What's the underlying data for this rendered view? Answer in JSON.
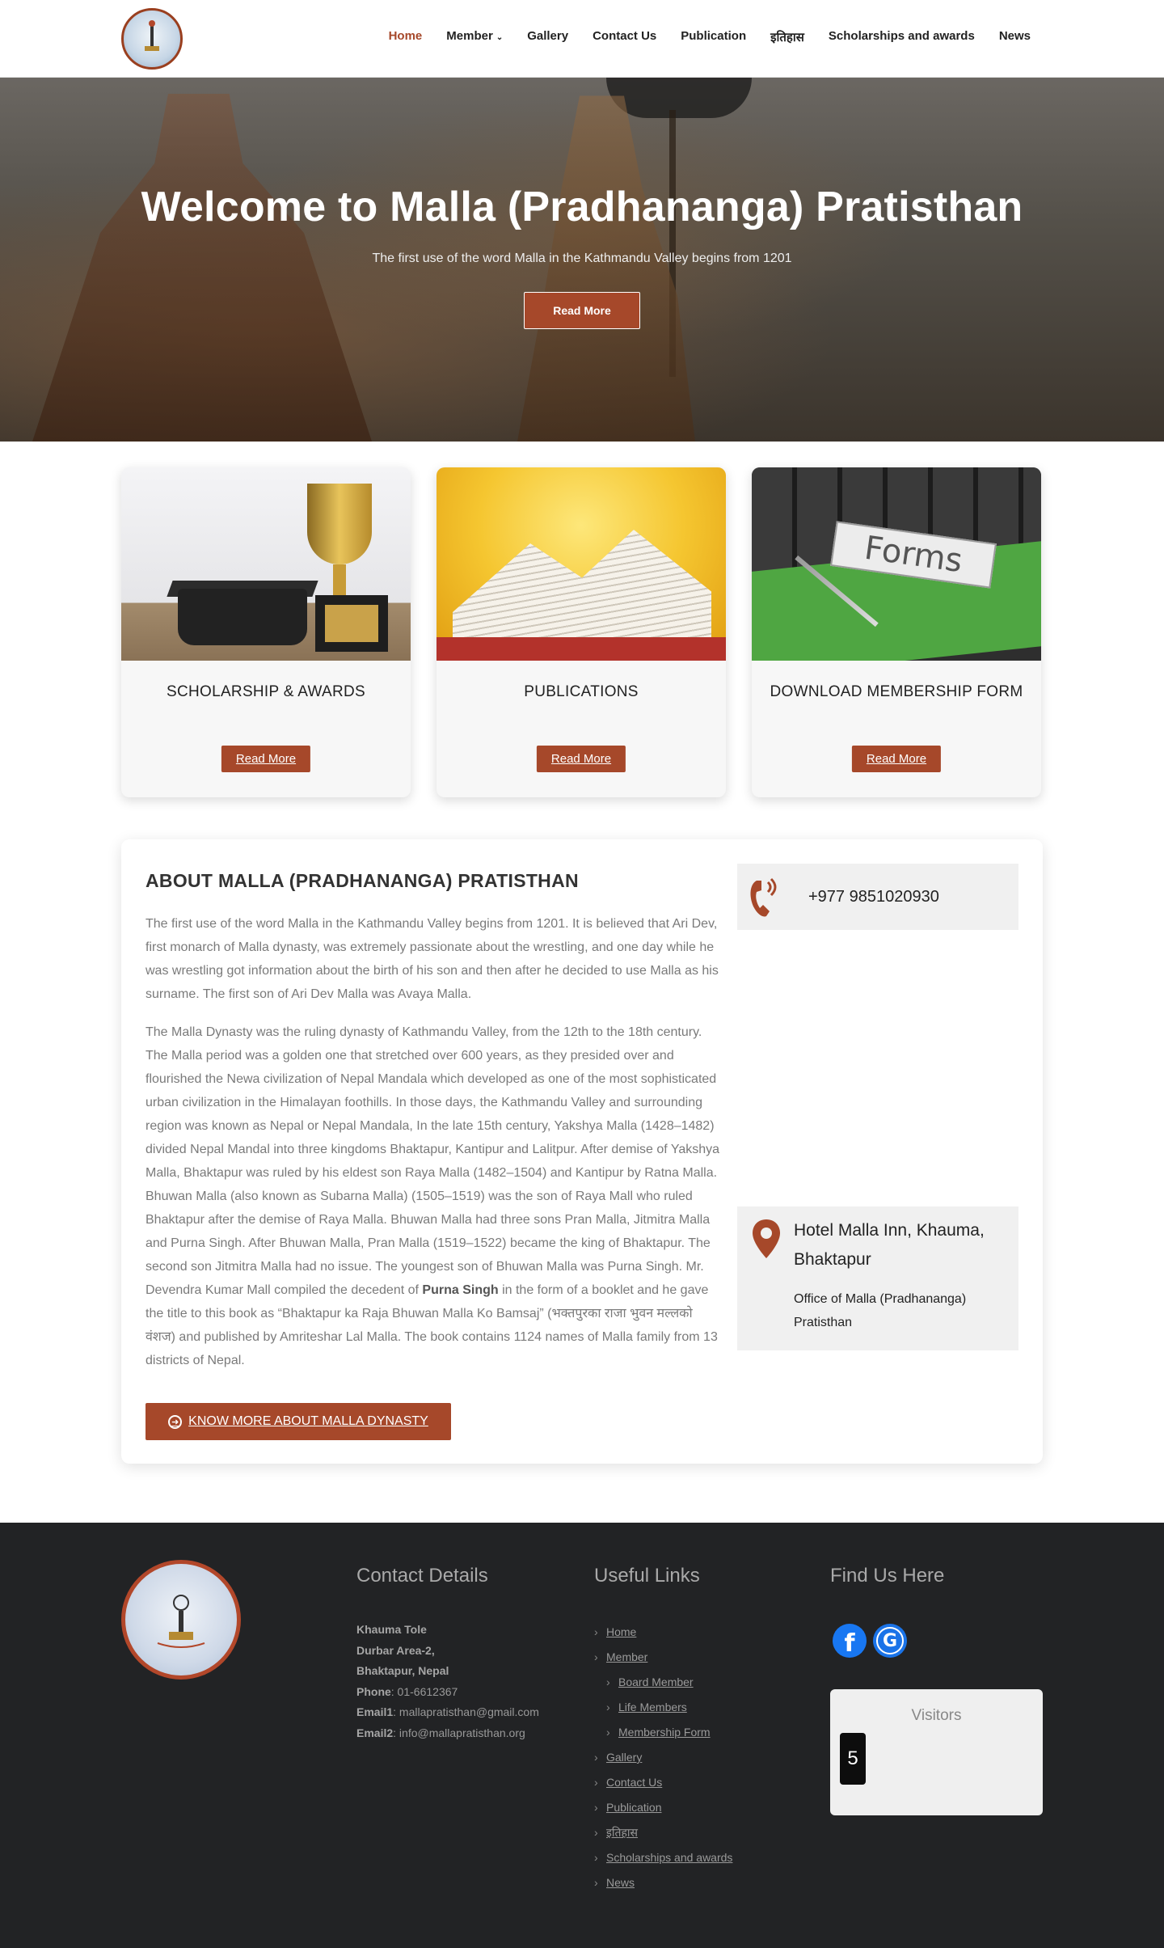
{
  "nav": {
    "items": [
      {
        "label": "Home",
        "active": true
      },
      {
        "label": "Member",
        "has_dropdown": true
      },
      {
        "label": "Gallery"
      },
      {
        "label": "Contact Us"
      },
      {
        "label": "Publication"
      },
      {
        "label": "इतिहास"
      },
      {
        "label": "Scholarships and awards"
      },
      {
        "label": "News"
      }
    ]
  },
  "hero": {
    "title": "Welcome to Malla (Pradhananga) Pratisthan",
    "subtitle": "The first use of the word Malla in the Kathmandu Valley begins from 1201",
    "button": "Read More"
  },
  "cards": [
    {
      "title": "SCHOLARSHIP & AWARDS",
      "button": "Read More"
    },
    {
      "title": "PUBLICATIONS",
      "button": "Read More"
    },
    {
      "title": "DOWNLOAD MEMBERSHIP FORM",
      "button": "Read More",
      "image_text": "Forms"
    }
  ],
  "about": {
    "title": "ABOUT MALLA (PRADHANANGA) PRATISTHAN",
    "p1": "The first use of the word Malla in the Kathmandu Valley begins from 1201. It is believed that Ari Dev, first monarch of Malla dynasty, was extremely passionate about the wrestling, and one day while he was wrestling got information about the birth of his son and then after he decided to use Malla as his surname. The first son of Ari Dev Malla was Avaya Malla.",
    "p2_before": "The Malla Dynasty was the ruling dynasty of Kathmandu Valley, from the 12th to the 18th century. The Malla period was a golden one that stretched over 600 years, as they presided over and flourished the Newa civilization of Nepal Mandala which developed as one of the most sophisticated urban civilization in the Himalayan foothills. In those days, the Kathmandu Valley and surrounding region was known as Nepal or Nepal Mandala, In the late 15th century, Yakshya Malla (1428–1482) divided Nepal Mandal into three kingdoms Bhaktapur, Kantipur and Lalitpur.  After demise of Yakshya Malla, Bhaktapur was ruled by his eldest son Raya Malla (1482–1504) and Kantipur by Ratna Malla. Bhuwan Malla (also known as Subarna Malla) (1505–1519) was the son of Raya Mall who ruled Bhaktapur after the demise of Raya Malla. Bhuwan Malla had three sons Pran Malla, Jitmitra Malla and Purna Singh. After Bhuwan Malla, Pran Malla (1519–1522) became the king of Bhaktapur. The second son Jitmitra Malla had no issue. The youngest son of Bhuwan Malla was Purna Singh. Mr. Devendra Kumar Mall compiled the decedent of ",
    "p2_bold": "Purna Singh",
    "p2_after": " in the form of a booklet and he gave the title to this book as “Bhaktapur ka Raja Bhuwan Malla Ko Bamsaj” (भक्तपुरका राजा भुवन मल्लको वंशज) and published by Amriteshar Lal Malla. The book contains 1124 names of Malla family from 13 districts of Nepal.",
    "button": "KNOW MORE ABOUT MALLA DYNASTY",
    "phone": "+977 9851020930",
    "address_title": "Hotel Malla Inn, Khauma, Bhaktapur",
    "address_sub": "Office of Malla (Pradhananga) Pratisthan"
  },
  "footer": {
    "contact_title": "Contact Details",
    "links_title": "Useful Links",
    "find_title": "Find Us Here",
    "contact": {
      "line1": "Khauma Tole",
      "line2": "Durbar Area-2,",
      "line3": "Bhaktapur, Nepal",
      "phone_label": "Phone",
      "phone": ": 01-6612367",
      "email1_label": "Email1",
      "email1": ": mallapratisthan@gmail.com",
      "email2_label": "Email2",
      "email2": ": info@mallapratisthan.org"
    },
    "links": [
      {
        "label": "Home",
        "sub": false
      },
      {
        "label": "Member",
        "sub": false
      },
      {
        "label": "Board Member",
        "sub": true
      },
      {
        "label": "Life Members",
        "sub": true
      },
      {
        "label": "Membership Form",
        "sub": true
      },
      {
        "label": "Gallery",
        "sub": false
      },
      {
        "label": "Contact Us",
        "sub": false
      },
      {
        "label": "Publication",
        "sub": false
      },
      {
        "label": "इतिहास",
        "sub": false
      },
      {
        "label": "Scholarships and awards",
        "sub": false
      },
      {
        "label": "News",
        "sub": false
      }
    ],
    "social": {
      "facebook_glyph": "f",
      "google_glyph": "G"
    },
    "visitors_title": "Visitors",
    "visitors_count": "5"
  },
  "colors": {
    "accent": "#a6482a",
    "footer_bg": "#222325"
  }
}
